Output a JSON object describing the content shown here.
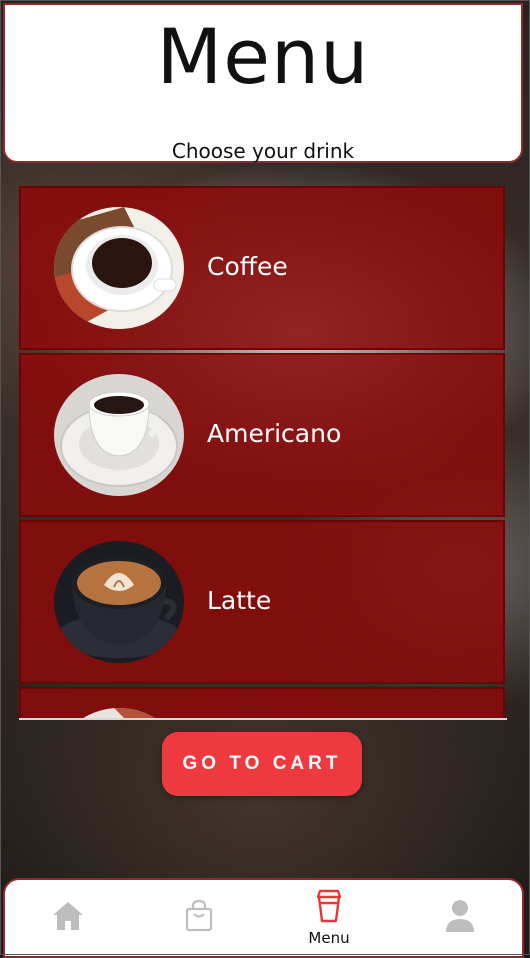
{
  "header": {
    "title": "Menu",
    "subtitle": "Choose your drink"
  },
  "menu": {
    "items": [
      {
        "label": "Coffee",
        "photo": "coffee-cup-on-wooden-board"
      },
      {
        "label": "Americano",
        "photo": "americano-cup-on-saucer"
      },
      {
        "label": "Latte",
        "photo": "latte-art-cup"
      },
      {
        "label": "",
        "photo": "partially-visible-next-item"
      }
    ]
  },
  "actions": {
    "cart_label": "GO TO CART"
  },
  "bottom_nav": {
    "items": [
      {
        "icon": "home-icon",
        "label": ""
      },
      {
        "icon": "shopping-bag-icon",
        "label": ""
      },
      {
        "icon": "cup-icon",
        "label": "Menu",
        "active": true
      },
      {
        "icon": "user-icon",
        "label": ""
      }
    ]
  },
  "colors": {
    "accent": "#ee3a3f",
    "item_background": "#8b0a0a",
    "border": "#8e2a2a",
    "active_nav": "#e53935",
    "inactive_nav": "#bdbdbd"
  }
}
